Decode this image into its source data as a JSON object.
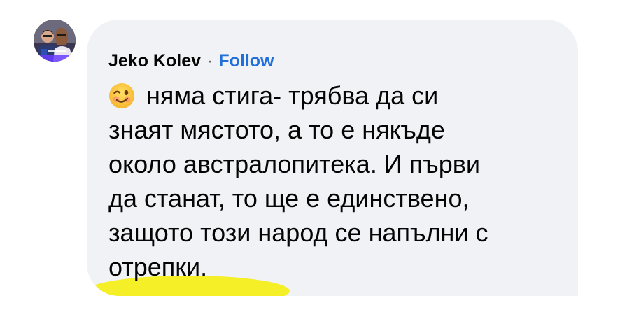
{
  "comment": {
    "author": "Jeko Kolev",
    "separator": "·",
    "follow_label": "Follow",
    "emoji": "winking-face",
    "lines": [
      "няма стига- трябва да си",
      "знаят мястото, а то е някъде",
      "около австралопитека. И първи",
      "да станат, то ще е единствено,",
      "защото този народ се напълни с",
      "отрепки."
    ]
  },
  "colors": {
    "bubble": "#f0f2f5",
    "name_text": "#050505",
    "follow": "#216fdb",
    "highlight": "#f4ee1c"
  }
}
